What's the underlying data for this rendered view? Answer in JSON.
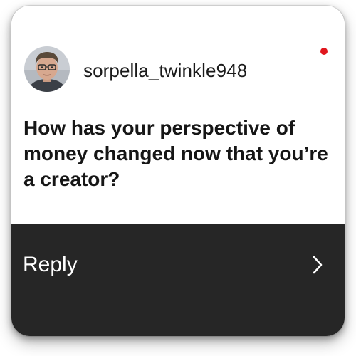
{
  "card": {
    "username": "sorpella_twinkle948",
    "question": "How has your perspective of money changed now that you’re a creator?",
    "unread_indicator_color": "#e0161d"
  },
  "reply": {
    "label": "Reply",
    "icon": "chevron-right-icon"
  },
  "avatar": {
    "icon": "user-avatar-photo"
  }
}
